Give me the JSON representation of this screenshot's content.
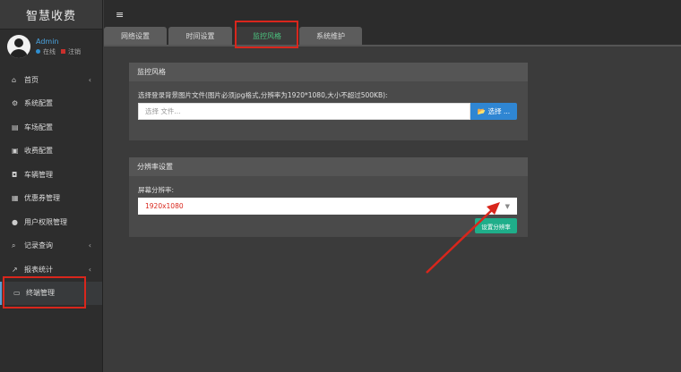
{
  "app": {
    "title": "智慧收费"
  },
  "user": {
    "name": "Admin",
    "status_online": "在线",
    "logout": "注销"
  },
  "sidebar": {
    "items": [
      {
        "label": "首页",
        "icon": "home-icon",
        "glyph": "⌂",
        "has_caret": true
      },
      {
        "label": "系统配置",
        "icon": "cogs-icon",
        "glyph": "⚙",
        "has_caret": false
      },
      {
        "label": "车场配置",
        "icon": "file-icon",
        "glyph": "▤",
        "has_caret": false
      },
      {
        "label": "收费配置",
        "icon": "money-icon",
        "glyph": "▣",
        "has_caret": false
      },
      {
        "label": "车辆管理",
        "icon": "car-icon",
        "glyph": "◘",
        "has_caret": false
      },
      {
        "label": "优惠券管理",
        "icon": "calendar-icon",
        "glyph": "▦",
        "has_caret": false
      },
      {
        "label": "用户权限管理",
        "icon": "user-icon",
        "glyph": "●",
        "has_caret": false
      },
      {
        "label": "记录查询",
        "icon": "search-icon",
        "glyph": "⌕",
        "has_caret": true
      },
      {
        "label": "报表统计",
        "icon": "chart-icon",
        "glyph": "↗",
        "has_caret": true
      },
      {
        "label": "终端管理",
        "icon": "monitor-icon",
        "glyph": "▭",
        "has_caret": false
      }
    ],
    "caret": "‹"
  },
  "topbar": {
    "menu_glyph": "≡"
  },
  "tabs": [
    {
      "label": "网络设置"
    },
    {
      "label": "时间设置"
    },
    {
      "label": "监控风格"
    },
    {
      "label": "系统维护"
    }
  ],
  "panel_monitor": {
    "title": "监控风格",
    "file_label": "选择登录背景图片文件(图片必须jpg格式,分辨率为1920*1080,大小不超过500KB):",
    "file_placeholder": "选择 文件...",
    "choose_button": "📂 选择 ..."
  },
  "panel_resolution": {
    "title": "分辨率设置",
    "screen_label": "屏幕分辨率:",
    "selected_value": "1920x1080",
    "set_button": "设置分辨率"
  },
  "colors": {
    "accent_blue": "#2f86d3",
    "accent_green": "#1fae8a",
    "active_tab_text": "#4bc27e",
    "annotation_red": "#d9261c"
  }
}
